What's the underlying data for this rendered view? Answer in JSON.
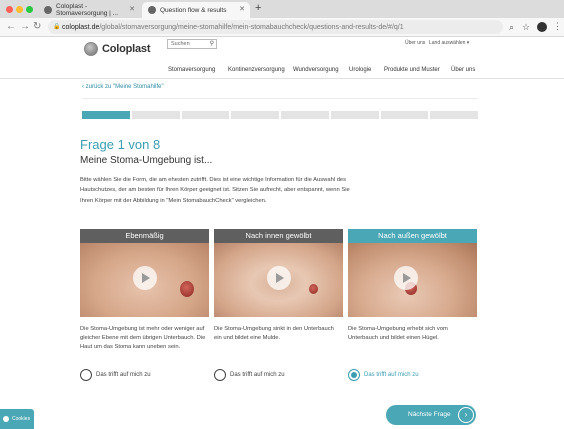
{
  "browser": {
    "tabs": [
      {
        "title": "Coloplast - Stomaversorgung | ..."
      },
      {
        "title": "Question flow & results"
      }
    ],
    "url_domain": "coloplast.de",
    "url_path": "/global/stomaversorgung/meine-stomahilfe/mein-stomabauchcheck/questions-and-results-de/#/q/1"
  },
  "site": {
    "logo_text": "Coloplast",
    "search_placeholder": "Suchen",
    "util_about": "Über uns",
    "util_country": "Land auswählen ▾",
    "nav": [
      "Stomaversorgung",
      "Kontinenzversorgung",
      "Wundversorgung",
      "Urologie",
      "Produkte und Muster",
      "Über uns"
    ]
  },
  "page": {
    "back_link": "zurück zu \"Meine Stomahilfe\"",
    "progress": {
      "current": 1,
      "total": 8
    },
    "question_number": "Frage 1 von 8",
    "question_title": "Meine Stoma-Umgebung ist...",
    "question_text": "Bitte wählen Sie die Form, die am ehesten zutrifft. Dies ist eine wichtige Information für die Auswahl des Hautschutzes, der am besten für Ihren Körper geeignet ist. Sitzen Sie aufrecht, aber entspannt, wenn Sie Ihren Körper mit der Abbildung in \"Mein StomabauchCheck\" vergleichen.",
    "options": [
      {
        "heading": "Ebenmäßig",
        "description": "Die Stoma-Umgebung ist mehr oder weniger auf gleicher Ebene mit dem übrigen Unterbauch. Die Haut um das Stoma kann uneben sein.",
        "radio_label": "Das trifft auf mich zu",
        "selected": false
      },
      {
        "heading": "Nach innen gewölbt",
        "description": "Die Stoma-Umgebung sinkt in den Unterbauch ein und bildet eine Mulde.",
        "radio_label": "Das trifft auf mich zu",
        "selected": false
      },
      {
        "heading": "Nach außen gewölbt",
        "description": "Die Stoma-Umgebung erhebt sich vom Unterbauch und bildet einen Hügel.",
        "radio_label": "Das trifft auf mich zu",
        "selected": true
      }
    ],
    "next_button": "Nächste Frage",
    "cookies_label": "Cookies"
  },
  "colors": {
    "accent": "#4aa7b6",
    "header_inactive": "#5f5f5f",
    "header_active": "#4aa7b6"
  }
}
